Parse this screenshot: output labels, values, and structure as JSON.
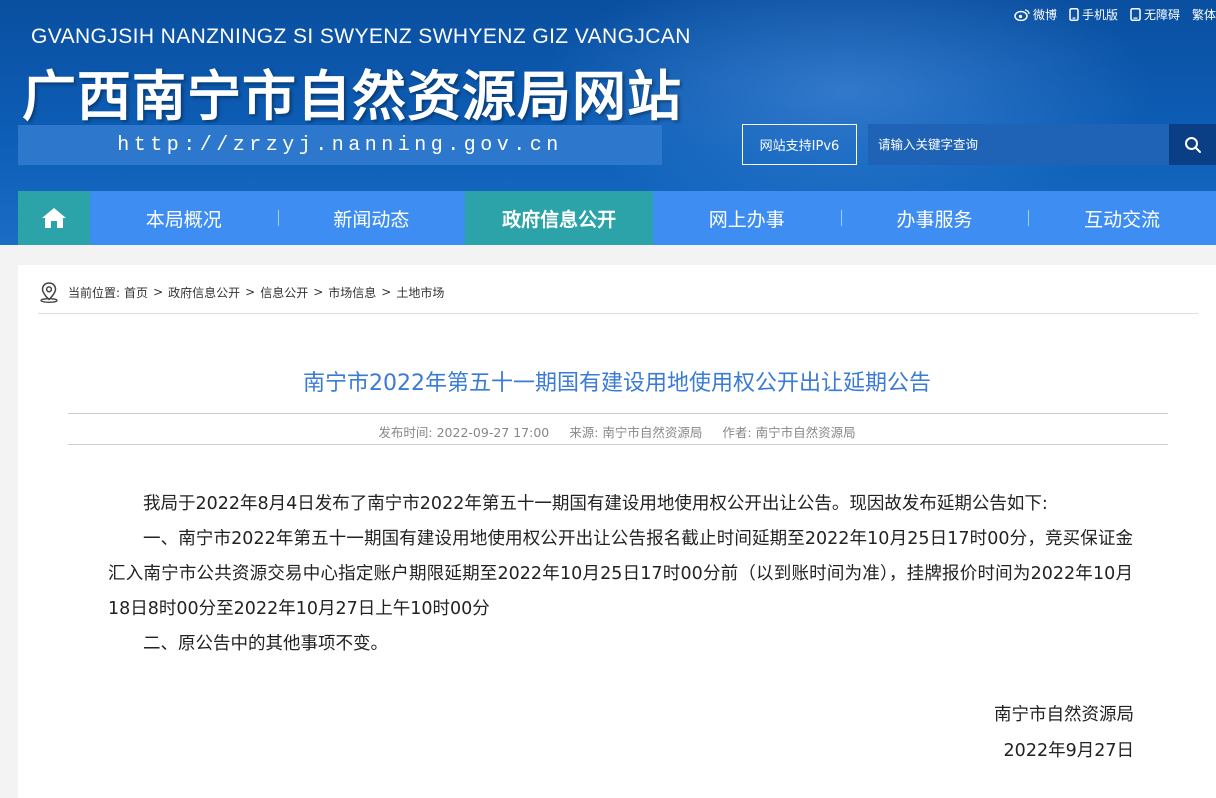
{
  "header": {
    "top_links": [
      {
        "label": "微博",
        "icon": "weibo-icon"
      },
      {
        "label": "手机版",
        "icon": "mobile-icon"
      },
      {
        "label": "无障碍",
        "icon": "accessibility-icon"
      },
      {
        "label": "繁体",
        "icon": ""
      }
    ],
    "roman_title": "GVANGJSIH NANZNINGZ SI SWYENZ SWHYENZ GIZ VANGJCAN",
    "site_title": "广西南宁市自然资源局网站",
    "url": "http://zrzyj.nanning.gov.cn",
    "ipv6_label": "网站支持IPv6",
    "search_placeholder": "请输入关键字查询"
  },
  "nav": {
    "home_icon": "home-icon",
    "items": [
      {
        "label": "本局概况"
      },
      {
        "label": "新闻动态"
      },
      {
        "label": "政府信息公开",
        "active": true
      },
      {
        "label": "网上办事"
      },
      {
        "label": "办事服务"
      },
      {
        "label": "互动交流"
      }
    ]
  },
  "breadcrumb": {
    "prefix": "当前位置:",
    "items": [
      "首页",
      "政府信息公开",
      "信息公开",
      "市场信息",
      "土地市场"
    ],
    "separator": ">"
  },
  "article": {
    "title": "南宁市2022年第五十一期国有建设用地使用权公开出让延期公告",
    "meta": {
      "publish_time": "发布时间: 2022-09-27 17:00",
      "source": "来源: 南宁市自然资源局",
      "author": "作者: 南宁市自然资源局"
    },
    "paragraphs": [
      "我局于2022年8月4日发布了南宁市2022年第五十一期国有建设用地使用权公开出让公告。现因故发布延期公告如下:",
      "一、南宁市2022年第五十一期国有建设用地使用权公开出让公告报名截止时间延期至2022年10月25日17时00分，竞买保证金汇入南宁市公共资源交易中心指定账户期限延期至2022年10月25日17时00分前（以到账时间为准），挂牌报价时间为2022年10月18日8时00分至2022年10月27日上午10时00分",
      "二、原公告中的其他事项不变。"
    ],
    "signature_org": "南宁市自然资源局",
    "signature_date": "2022年9月27日"
  },
  "colors": {
    "header_blue": "#0d5fb8",
    "nav_blue": "#3e8df3",
    "nav_active": "#2ba3a8",
    "title_blue": "#3a7bd5"
  }
}
